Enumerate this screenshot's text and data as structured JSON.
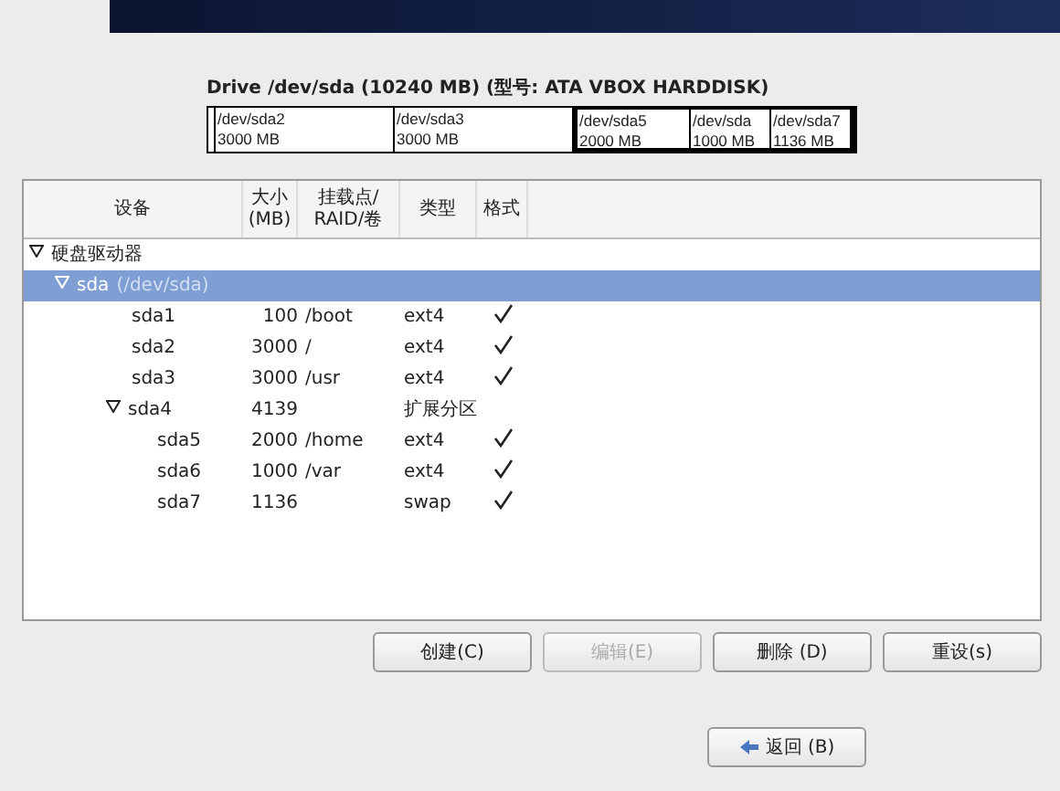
{
  "drive": {
    "title": "Drive /dev/sda (10240 MB) (型号: ATA VBOX HARDDISK)",
    "segments": [
      {
        "kind": "partition"
      },
      {
        "kind": "partition",
        "name": "/dev/sda2",
        "size": "3000 MB"
      },
      {
        "kind": "partition",
        "name": "/dev/sda3",
        "size": "3000 MB"
      },
      {
        "kind": "extended",
        "children": [
          {
            "kind": "partition",
            "name": "/dev/sda5",
            "size": "2000 MB"
          },
          {
            "kind": "partition",
            "name": "/dev/sda",
            "size": "1000 MB"
          },
          {
            "kind": "partition",
            "name": "/dev/sda7",
            "size": "1136 MB"
          }
        ]
      }
    ]
  },
  "table": {
    "columns": [
      "设备",
      "大小\n(MB)",
      "挂载点/\nRAID/卷",
      "类型",
      "格式"
    ],
    "tree": [
      {
        "label": "硬盘驱动器",
        "expanded": true,
        "selected": false,
        "children": [
          {
            "label": "sda",
            "note": "(/dev/sda)",
            "expanded": true,
            "selected": true,
            "children": [
              {
                "label": "sda1",
                "size": "100",
                "mount": "/boot",
                "type": "ext4",
                "format": true,
                "selected": false
              },
              {
                "label": "sda2",
                "size": "3000",
                "mount": "/",
                "type": "ext4",
                "format": true,
                "selected": false
              },
              {
                "label": "sda3",
                "size": "3000",
                "mount": "/usr",
                "type": "ext4",
                "format": true,
                "selected": false
              },
              {
                "label": "sda4",
                "size": "4139",
                "type": "扩展分区",
                "format": false,
                "expanded": true,
                "selected": false,
                "children": [
                  {
                    "label": "sda5",
                    "size": "2000",
                    "mount": "/home",
                    "type": "ext4",
                    "format": true,
                    "selected": false
                  },
                  {
                    "label": "sda6",
                    "size": "1000",
                    "mount": "/var",
                    "type": "ext4",
                    "format": true,
                    "selected": false
                  },
                  {
                    "label": "sda7",
                    "size": "1136",
                    "type": "swap",
                    "format": true,
                    "selected": false
                  }
                ]
              }
            ]
          }
        ]
      }
    ]
  },
  "buttons": [
    {
      "label": "创建(C)",
      "disabled": false
    },
    {
      "label": "编辑(E)",
      "disabled": true
    },
    {
      "label": "删除 (D)",
      "disabled": false
    },
    {
      "label": "重设(s)",
      "disabled": false
    }
  ],
  "back_button": {
    "label": "返回 (B)"
  }
}
